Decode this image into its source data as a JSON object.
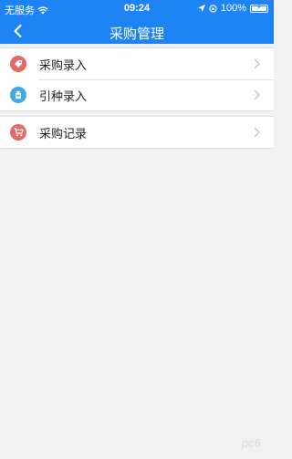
{
  "status_bar": {
    "carrier": "无服务",
    "time": "09:24",
    "battery": "100%"
  },
  "nav": {
    "title": "采购管理"
  },
  "menu_groups": [
    {
      "items": [
        {
          "label": "采购录入",
          "icon": "tag-icon",
          "color": "#e56a6a"
        },
        {
          "label": "引种录入",
          "icon": "bottle-icon",
          "color": "#45a8e0"
        }
      ]
    },
    {
      "items": [
        {
          "label": "采购记录",
          "icon": "cart-icon",
          "color": "#e56a6a"
        }
      ]
    }
  ],
  "colors": {
    "accent": "#1e83f5",
    "background": "#f1f1f1"
  },
  "watermark": "pc6"
}
